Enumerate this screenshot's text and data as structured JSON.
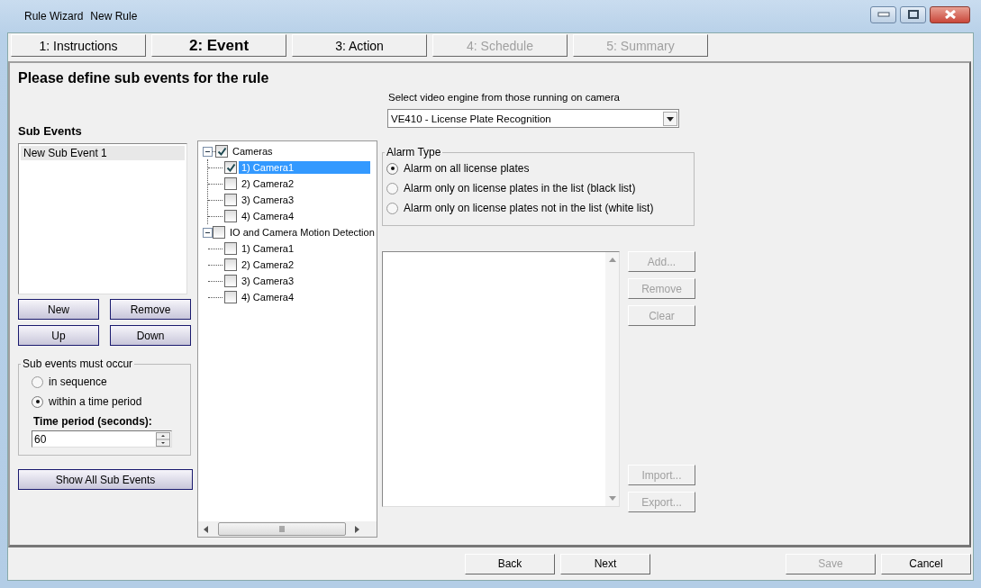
{
  "window": {
    "title": "Rule Wizard",
    "subtitle": "New Rule"
  },
  "tabs": [
    {
      "label": "1: Instructions",
      "selected": false,
      "disabled": false
    },
    {
      "label": "2: Event",
      "selected": true,
      "disabled": false
    },
    {
      "label": "3: Action",
      "selected": false,
      "disabled": false
    },
    {
      "label": "4: Schedule",
      "selected": false,
      "disabled": true
    },
    {
      "label": "5: Summary",
      "selected": false,
      "disabled": true
    }
  ],
  "heading": "Please define sub events for the rule",
  "sub_events": {
    "title": "Sub Events",
    "items": [
      {
        "label": "New Sub Event 1",
        "selected": true
      }
    ],
    "buttons": [
      "New",
      "Remove",
      "Up",
      "Down"
    ]
  },
  "occur_group": {
    "legend": "Sub events must occur",
    "options": [
      {
        "label": "in sequence",
        "selected": false
      },
      {
        "label": "within a time period",
        "selected": true
      }
    ],
    "time_label": "Time period (seconds):",
    "time_value": "60"
  },
  "show_all_button": "Show All Sub Events",
  "tree": [
    {
      "label": "Cameras",
      "checked": true,
      "expanded": true,
      "selected": false,
      "children": [
        {
          "label": "1) Camera1",
          "checked": true,
          "selected": true
        },
        {
          "label": "2) Camera2",
          "checked": false,
          "selected": false
        },
        {
          "label": "3) Camera3",
          "checked": false,
          "selected": false
        },
        {
          "label": "4) Camera4",
          "checked": false,
          "selected": false
        }
      ]
    },
    {
      "label": "IO and Camera Motion Detection",
      "checked": false,
      "expanded": true,
      "selected": false,
      "children": [
        {
          "label": "1) Camera1",
          "checked": false,
          "selected": false
        },
        {
          "label": "2) Camera2",
          "checked": false,
          "selected": false
        },
        {
          "label": "3) Camera3",
          "checked": false,
          "selected": false
        },
        {
          "label": "4) Camera4",
          "checked": false,
          "selected": false
        }
      ]
    }
  ],
  "engine": {
    "label": "Select video engine from those running on camera",
    "value": "VE410 - License Plate Recognition"
  },
  "alarm_type": {
    "legend": "Alarm Type",
    "options": [
      {
        "label": "Alarm on all license plates",
        "selected": true
      },
      {
        "label": "Alarm only on license plates in the list (black list)",
        "selected": false
      },
      {
        "label": "Alarm only on license plates not in the list (white list)",
        "selected": false
      }
    ]
  },
  "plate_buttons_top": [
    {
      "label": "Add...",
      "disabled": true
    },
    {
      "label": "Remove",
      "disabled": true
    },
    {
      "label": "Clear",
      "disabled": true
    }
  ],
  "plate_buttons_bottom": [
    {
      "label": "Import...",
      "disabled": true
    },
    {
      "label": "Export...",
      "disabled": true
    }
  ],
  "footer_left": [
    {
      "label": "Back",
      "disabled": false
    },
    {
      "label": "Next",
      "disabled": false
    }
  ],
  "footer_right": [
    {
      "label": "Save",
      "disabled": true
    },
    {
      "label": "Cancel",
      "disabled": false
    }
  ]
}
